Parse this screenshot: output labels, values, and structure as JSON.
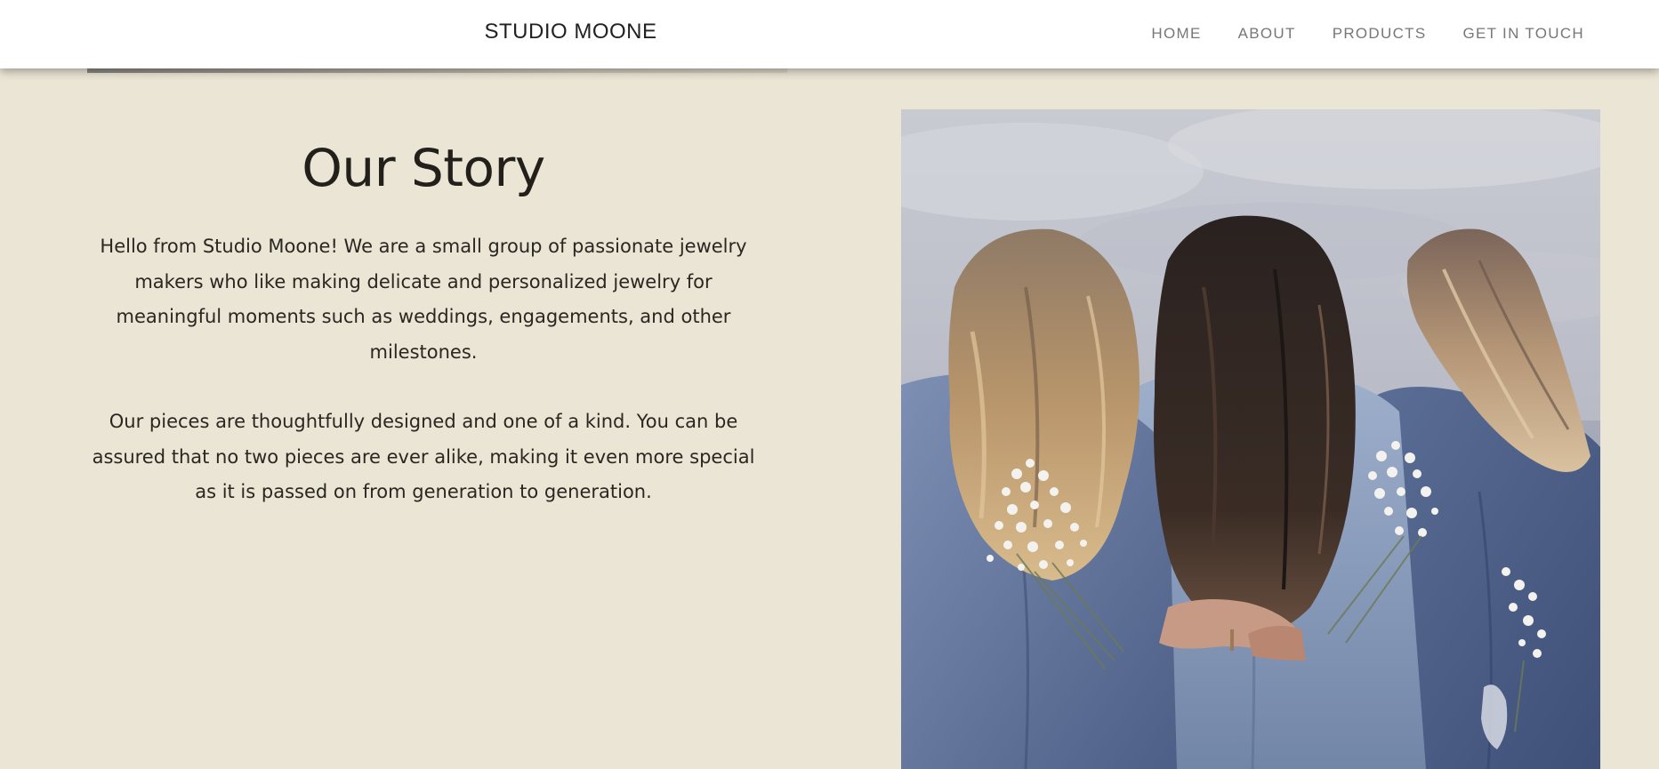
{
  "header": {
    "brand": "STUDIO MOONE",
    "nav": [
      {
        "label": "HOME"
      },
      {
        "label": "ABOUT"
      },
      {
        "label": "PRODUCTS"
      },
      {
        "label": "GET IN TOUCH"
      }
    ]
  },
  "story": {
    "title": "Our Story",
    "paragraphs": [
      "Hello from Studio Moone! We are a small group of passionate jewelry makers who like making delicate and personalized jewelry for meaningful moments such as weddings, engagements, and other milestones.",
      "Our pieces are thoughtfully designed and one of a kind. You can be assured that no two pieces are ever alike, making it even more special as it is passed on from generation to generation."
    ]
  },
  "colors": {
    "background": "#ebe5d5",
    "header": "#ffffff",
    "text": "#2a2621",
    "nav_text": "#777777"
  }
}
